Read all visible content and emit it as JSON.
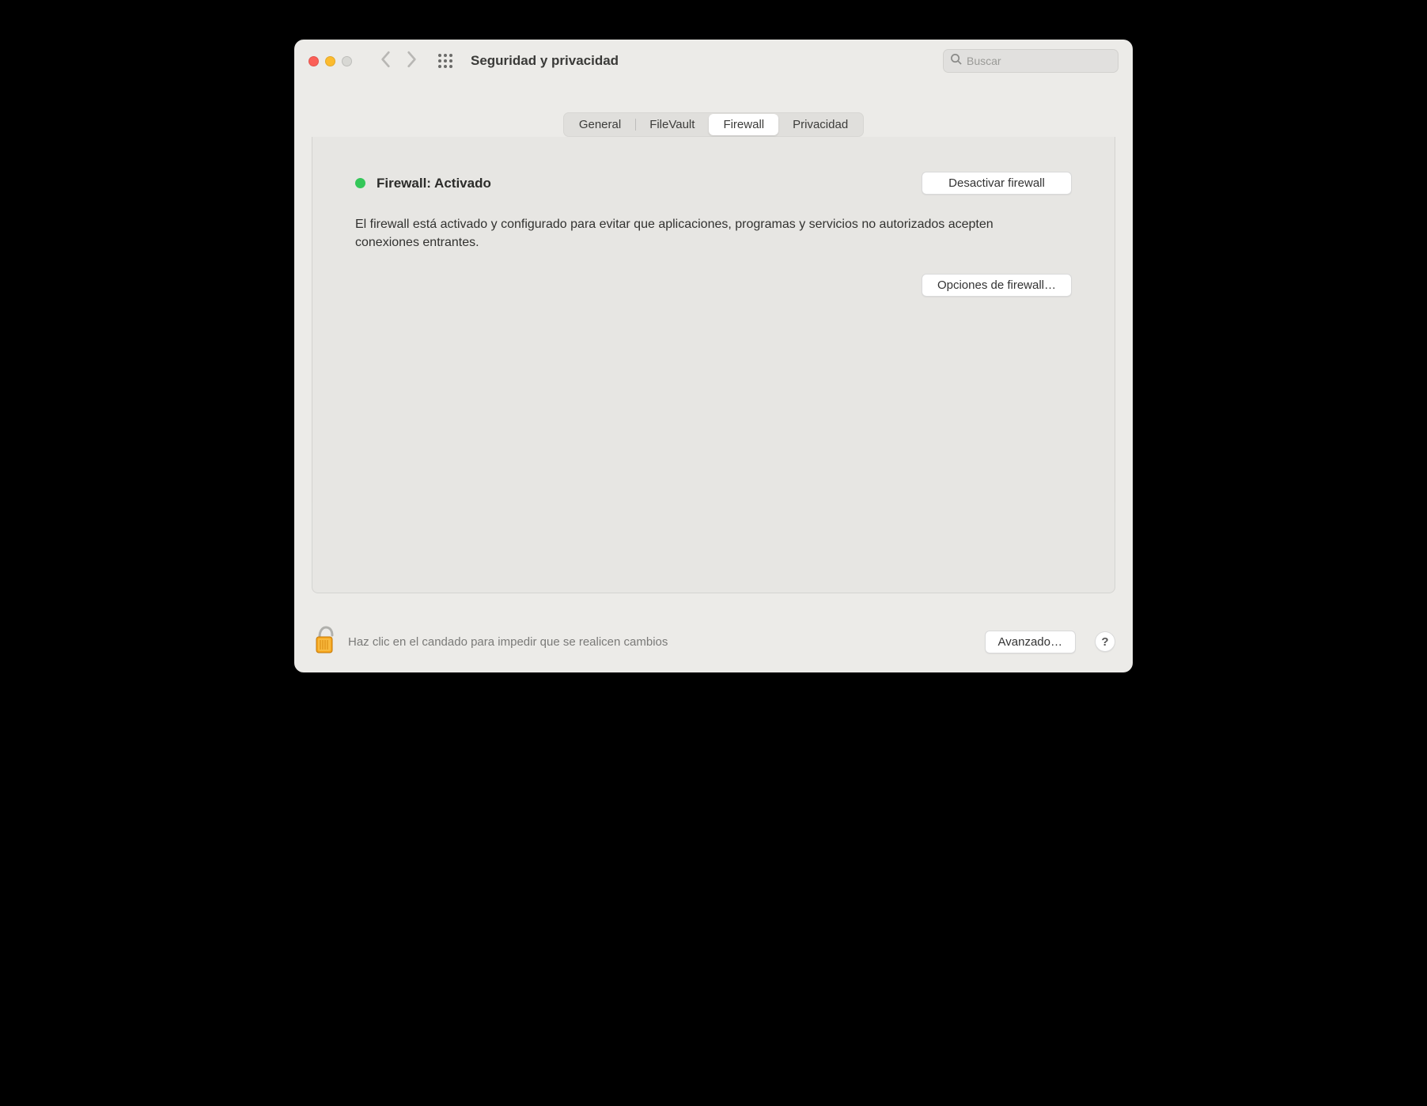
{
  "window_title": "Seguridad y privacidad",
  "search": {
    "placeholder": "Buscar"
  },
  "tabs": {
    "general": "General",
    "filevault": "FileVault",
    "firewall": "Firewall",
    "privacy": "Privacidad"
  },
  "firewall": {
    "status_label": "Firewall: Activado",
    "disable_button": "Desactivar firewall",
    "description": "El firewall está activado y configurado para evitar que aplicaciones, programas y servicios no autorizados acepten conexiones entrantes.",
    "options_button": "Opciones de firewall…"
  },
  "footer": {
    "lock_text": "Haz clic en el candado para impedir que se realicen cambios",
    "advanced_button": "Avanzado…",
    "help_label": "?"
  }
}
